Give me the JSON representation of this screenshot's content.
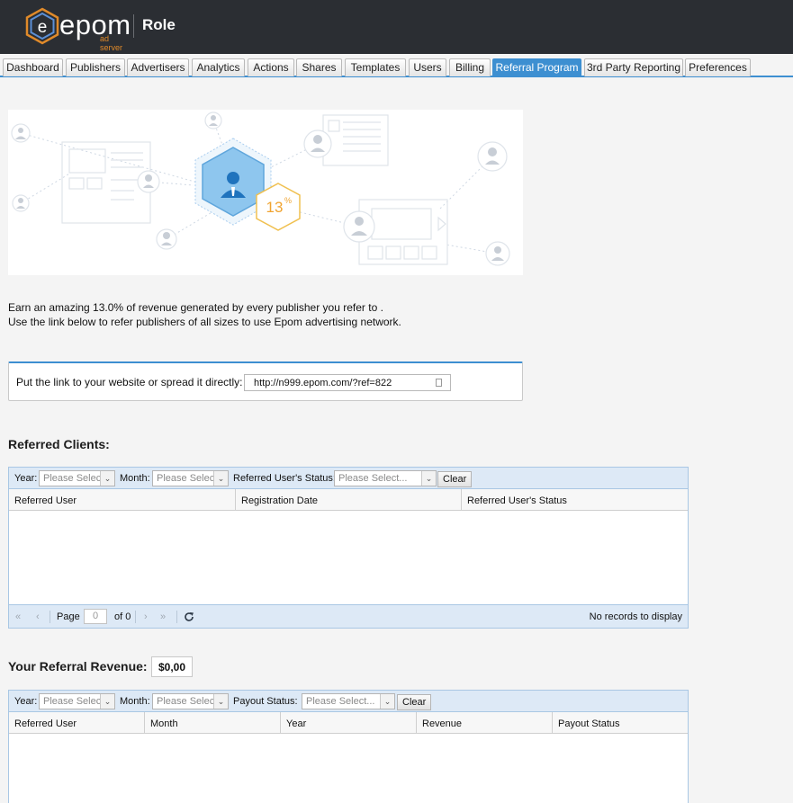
{
  "header": {
    "logo_text": "epom",
    "logo_sub": "ad server",
    "title": "Role"
  },
  "tabs": [
    {
      "label": "Dashboard",
      "active": false
    },
    {
      "label": "Publishers",
      "active": false
    },
    {
      "label": "Advertisers",
      "active": false
    },
    {
      "label": "Analytics",
      "active": false
    },
    {
      "label": "Actions",
      "active": false
    },
    {
      "label": "Shares",
      "active": false
    },
    {
      "label": "Templates",
      "active": false
    },
    {
      "label": "Users",
      "active": false
    },
    {
      "label": "Billing",
      "active": false
    },
    {
      "label": "Referral Program",
      "active": true
    },
    {
      "label": "3rd Party Reporting",
      "active": false
    },
    {
      "label": "Preferences",
      "active": false
    }
  ],
  "banner": {
    "percent": "13",
    "percent_sign": "%"
  },
  "description": {
    "line1": "Earn an amazing 13.0% of revenue generated by every publisher you refer to .",
    "line2": "Use the link below to refer publishers of all sizes to use Epom advertising network."
  },
  "referral_link": {
    "label": "Put the link to your website or spread it directly:",
    "value": "http://n999.epom.com/?ref=822"
  },
  "referred_clients": {
    "title": "Referred Clients:",
    "filters": {
      "year_label": "Year:",
      "year_placeholder": "Please Select...",
      "month_label": "Month:",
      "month_placeholder": "Please Select...",
      "status_label": "Referred User's Status:",
      "status_placeholder": "Please Select...",
      "clear_label": "Clear"
    },
    "columns": [
      "Referred User",
      "Registration Date",
      "Referred User's Status"
    ],
    "pager": {
      "page_label": "Page",
      "page_value": "0",
      "of_label": "of 0",
      "status": "No records to display"
    }
  },
  "referral_revenue": {
    "title": "Your Referral Revenue:",
    "amount": "$0,00",
    "filters": {
      "year_label": "Year:",
      "year_placeholder": "Please Select...",
      "month_label": "Month:",
      "month_placeholder": "Please Select...",
      "status_label": "Payout Status:",
      "status_placeholder": "Please Select...",
      "clear_label": "Clear"
    },
    "columns": [
      "Referred User",
      "Month",
      "Year",
      "Revenue",
      "Payout Status"
    ]
  },
  "colors": {
    "header_bg": "#2b2e33",
    "accent_blue": "#3d8fd1",
    "logo_orange": "#e08a2a",
    "badge_orange": "#f0a431",
    "grid_header_bg": "#dde9f6"
  }
}
